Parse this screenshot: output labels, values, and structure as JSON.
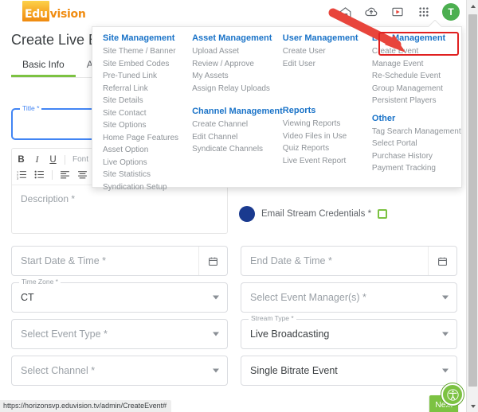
{
  "browser": {
    "status_url": "https://horizonsvp.eduvision.tv/admin/CreateEvent#"
  },
  "topbar": {
    "logo_primary": "Edu",
    "logo_secondary": "vision",
    "icons": [
      {
        "name": "home-icon",
        "label": "Home"
      },
      {
        "name": "cloud-upload-icon",
        "label": "Upload"
      },
      {
        "name": "video-box-icon",
        "label": "Video"
      },
      {
        "name": "apps-grid-icon",
        "label": "Apps"
      }
    ],
    "avatar_initial": "T"
  },
  "page": {
    "title": "Create Live Event",
    "tabs": [
      {
        "label": "Basic Info",
        "active": true
      },
      {
        "label": "Advanced",
        "active": false
      }
    ]
  },
  "form": {
    "title_field": {
      "legend": "Title *",
      "value": ""
    },
    "editor": {
      "placeholder": "Description *",
      "toolbar_row1": [
        {
          "name": "bold-icon",
          "glyph": "B"
        },
        {
          "name": "italic-icon",
          "glyph": "I"
        },
        {
          "name": "underline-icon",
          "glyph": "U"
        }
      ],
      "font_label": "Font",
      "toolbar_row2": [
        {
          "name": "numbered-list-icon"
        },
        {
          "name": "bullet-list-icon"
        },
        {
          "name": "align-left-icon"
        },
        {
          "name": "align-center-icon"
        },
        {
          "name": "align-right-icon"
        },
        {
          "name": "align-justify-icon"
        }
      ]
    },
    "email_credentials": {
      "label": "Email Stream Credentials *",
      "checked": false
    },
    "start_date": {
      "placeholder": "Start Date & Time *",
      "value": ""
    },
    "end_date": {
      "placeholder": "End Date & Time *",
      "value": ""
    },
    "time_zone": {
      "legend": "Time Zone *",
      "value": "CT"
    },
    "event_manager": {
      "placeholder": "Select Event Manager(s) *",
      "value": ""
    },
    "event_type": {
      "placeholder": "Select Event Type *",
      "value": ""
    },
    "stream_type": {
      "legend": "Stream Type *",
      "value": "Live Broadcasting"
    },
    "channel": {
      "placeholder": "Select Channel *",
      "value": ""
    },
    "bitrate": {
      "placeholder": "",
      "value": "Single Bitrate Event"
    },
    "next_button": "Next"
  },
  "accessibility_widget": {
    "name": "accessibility-icon"
  },
  "menu": {
    "columns": [
      {
        "groups": [
          {
            "heading": "Site Management",
            "items": [
              "Site Theme / Banner",
              "Site Embed Codes",
              "Pre-Tuned Link",
              "Referral Link",
              "Site Details",
              "Site Contact",
              "Site Options",
              "Home Page Features",
              "Asset Option",
              "Live Options",
              "Site Statistics",
              "Syndication Setup"
            ]
          }
        ]
      },
      {
        "groups": [
          {
            "heading": "Asset Management",
            "items": [
              "Upload Asset",
              "Review / Approve",
              "My Assets",
              "Assign Relay Uploads"
            ]
          },
          {
            "heading": "Channel Management",
            "items": [
              "Create Channel",
              "Edit Channel",
              "Syndicate Channels"
            ]
          }
        ]
      },
      {
        "groups": [
          {
            "heading": "User Management",
            "items": [
              "Create User",
              "Edit User"
            ]
          },
          {
            "heading": "Reports",
            "items": [
              "Viewing Reports",
              "Video Files in Use",
              "Quiz Reports",
              "Live Event Report"
            ]
          }
        ]
      },
      {
        "groups": [
          {
            "heading": "Live Management",
            "items": [
              "Create Event",
              "Manage Event",
              "Re-Schedule Event",
              "Group Management",
              "Persistent Players"
            ]
          },
          {
            "heading": "Other",
            "items": [
              "Tag Search Management",
              "Select Portal",
              "Purchase History",
              "Payment Tracking"
            ]
          }
        ]
      }
    ]
  },
  "annotation": {
    "highlight_color": "#e02020",
    "arrow_color": "#e8453c",
    "highlighted_item": "Create Event"
  },
  "colors": {
    "accent_green": "#7cc242",
    "link_blue": "#1a73c8",
    "focus_blue": "#4285f4",
    "logo_orange": "#f08c11"
  }
}
